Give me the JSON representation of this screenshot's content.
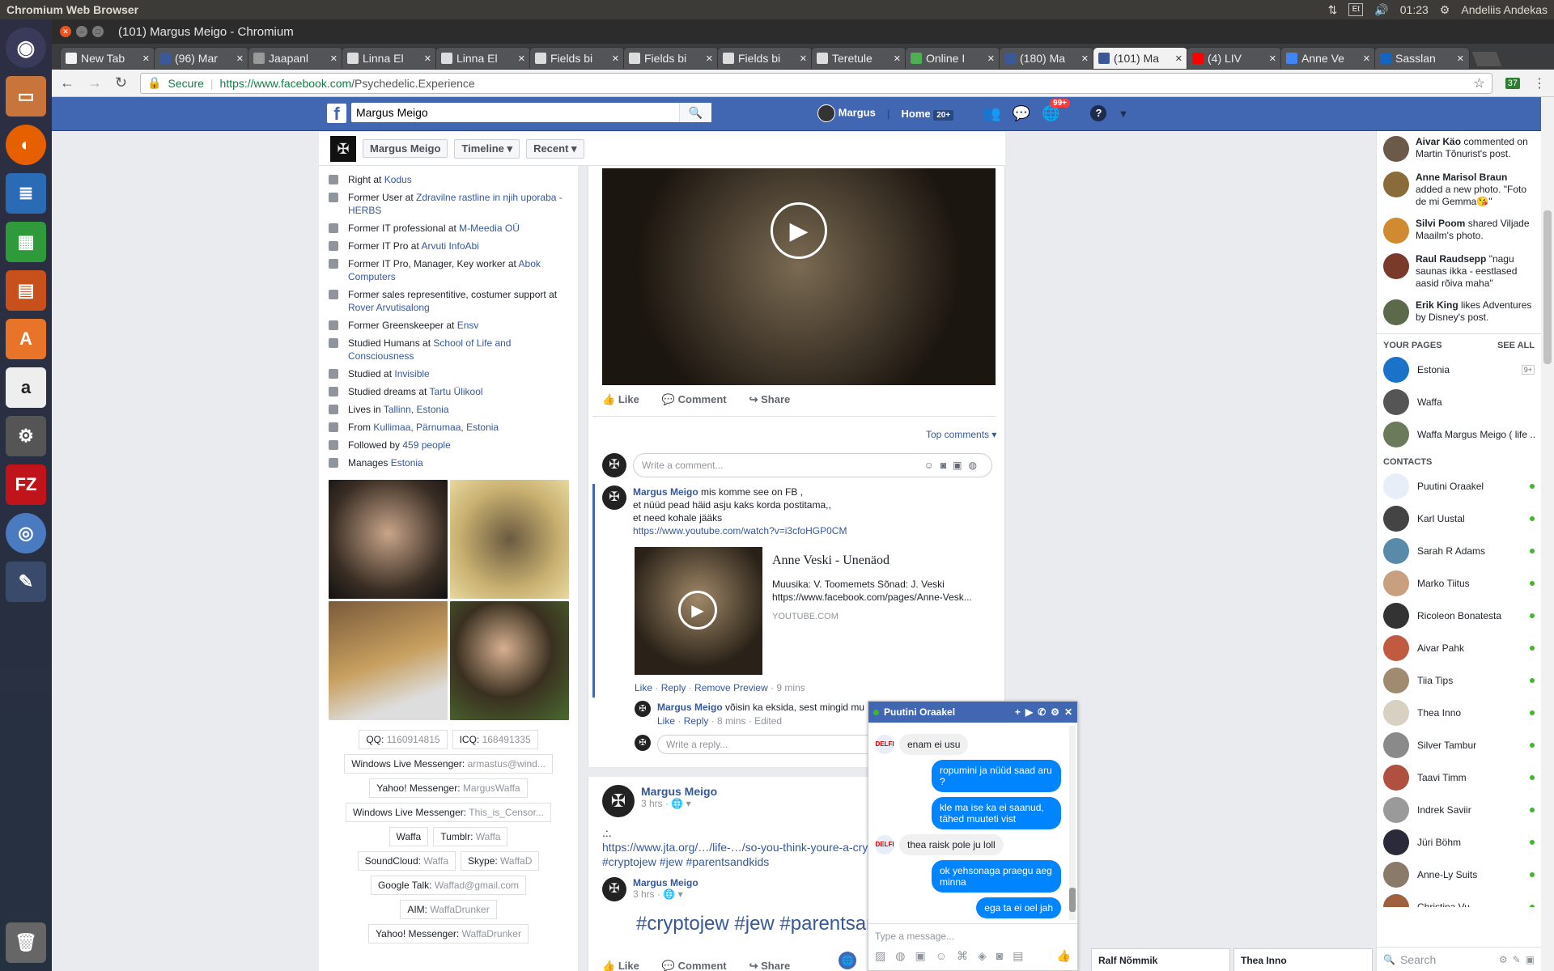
{
  "os": {
    "app_title": "Chromium Web Browser",
    "clock": "01:23",
    "keyboard": "Et",
    "user": "Andeliis Andekas"
  },
  "window": {
    "title": "(101) Margus Meigo - Chromium"
  },
  "tabs": [
    {
      "label": "New Tab",
      "color": "#f2f2f2"
    },
    {
      "label": "(96) Mar",
      "color": "#3b5998"
    },
    {
      "label": "Jaapanl",
      "color": "#999999"
    },
    {
      "label": "Linna El",
      "color": "#dddddd"
    },
    {
      "label": "Linna El",
      "color": "#dddddd"
    },
    {
      "label": "Fields bi",
      "color": "#dddddd"
    },
    {
      "label": "Fields bi",
      "color": "#dddddd"
    },
    {
      "label": "Fields bi",
      "color": "#dddddd"
    },
    {
      "label": "Teretule",
      "color": "#dddddd"
    },
    {
      "label": "Online I",
      "color": "#4caf50"
    },
    {
      "label": "(180) Ma",
      "color": "#3b5998"
    },
    {
      "label": "(101) Ma",
      "color": "#3b5998",
      "active": true
    },
    {
      "label": "(4) LIV",
      "color": "#ff0000"
    },
    {
      "label": "Anne Ve",
      "color": "#4285f4"
    },
    {
      "label": "Sasslan",
      "color": "#1565c0"
    }
  ],
  "address": {
    "secure": "Secure",
    "url_prefix": "https://www.facebook.com",
    "url_path": "/Psychedelic.Experience",
    "ext_badge": "37"
  },
  "fb": {
    "logo": "f",
    "search_value": "Margus Meigo",
    "user": "Margus",
    "home": "Home",
    "home_count": "20+",
    "notif_count": "99+",
    "help": "?"
  },
  "subnav": {
    "name": "Margus Meigo",
    "timeline": "Timeline",
    "recent": "Recent"
  },
  "about": [
    {
      "pre": "Right at ",
      "link": "Kodus",
      "icon": "briefcase-icon"
    },
    {
      "pre": "Former User at ",
      "link": "Zdravilne rastline in njih uporaba - HERBS",
      "icon": "briefcase-icon"
    },
    {
      "pre": "Former IT professional at ",
      "link": "M-Meedia OÜ",
      "icon": "briefcase-icon"
    },
    {
      "pre": "Former IT Pro at ",
      "link": "Arvuti InfoAbi",
      "icon": "briefcase-icon"
    },
    {
      "pre": "Former IT Pro, Manager, Key worker at ",
      "link": "Abok Computers",
      "icon": "briefcase-icon"
    },
    {
      "pre": "Former sales representitive, costumer support at ",
      "link": "Rover Arvutisalong",
      "icon": "briefcase-icon"
    },
    {
      "pre": "Former Greenskeeper at ",
      "link": "Ensv",
      "icon": "briefcase-icon"
    },
    {
      "pre": "Studied Humans at ",
      "link": "School of Life and Consciousness",
      "icon": "graduation-cap-icon"
    },
    {
      "pre": "Studied at ",
      "link": "Invisible",
      "icon": "graduation-cap-icon"
    },
    {
      "pre": "Studied dreams at ",
      "link": "Tartu Ülikool",
      "icon": "graduation-cap-icon"
    },
    {
      "pre": "Lives in ",
      "link": "Tallinn, Estonia",
      "icon": "home-icon"
    },
    {
      "pre": "From ",
      "link": "Kullimaa, Pärnumaa, Estonia",
      "icon": "location-pin-icon"
    },
    {
      "pre": "Followed by ",
      "link": "459 people",
      "icon": "rss-icon"
    },
    {
      "pre": "Manages ",
      "link": "Estonia",
      "icon": "flag-icon"
    }
  ],
  "contacts_info": [
    [
      {
        "k": "QQ:",
        "v": "1160914815"
      },
      {
        "k": "ICQ:",
        "v": "168491335"
      }
    ],
    [
      {
        "k": "Windows Live Messenger:",
        "v": "armastus@wind..."
      }
    ],
    [
      {
        "k": "Yahoo! Messenger:",
        "v": "MargusWaffa"
      }
    ],
    [
      {
        "k": "Windows Live Messenger:",
        "v": "This_is_Censor..."
      }
    ],
    [
      {
        "k": "Waffa",
        "v": ""
      },
      {
        "k": "Tumblr:",
        "v": "Waffa"
      }
    ],
    [
      {
        "k": "SoundCloud:",
        "v": "Waffa"
      },
      {
        "k": "Skype:",
        "v": "WaffaD"
      }
    ],
    [
      {
        "k": "Google Talk:",
        "v": "Waffad@gmail.com"
      }
    ],
    [
      {
        "k": "AIM:",
        "v": "WaffaDrunker"
      }
    ],
    [
      {
        "k": "Yahoo! Messenger:",
        "v": "WaffaDrunker"
      }
    ]
  ],
  "post1": {
    "like": "Like",
    "comment": "Comment",
    "share": "Share",
    "top_comments": "Top comments",
    "write_comment": "Write a comment...",
    "c1_author": "Margus Meigo",
    "c1_line1": "mis komme see on FB ,",
    "c1_line2": "et nüüd pead häid asju kaks korda postitama,,",
    "c1_line3": "et need kohale jääks",
    "c1_link": "https://www.youtube.com/watch?v=i3cfoHGP0CM",
    "preview_title": "Anne Veski - Unenäod",
    "preview_desc1": "Muusika: V. Toomemets Sõnad: J. Veski",
    "preview_desc2": "https://www.facebook.com/pages/Anne-Vesk...",
    "preview_source": "YOUTUBE.COM",
    "c1_like": "Like",
    "c1_reply": "Reply",
    "c1_remove": "Remove Preview",
    "c1_time": "9 mins",
    "c2_author": "Margus Meigo",
    "c2_text": "võisin ka eksida, sest mingid mu",
    "c2_like": "Like",
    "c2_reply": "Reply",
    "c2_time": "8 mins",
    "c2_edited": "Edited",
    "write_reply": "Write a reply..."
  },
  "post2": {
    "author": "Margus Meigo",
    "time": "3 hrs",
    "text0": ".:.",
    "link": "https://www.jta.org/…/life-…/so-you-think-youre-a-cry",
    "tags": "#cryptojew #jew #parentsandkids",
    "sub_author": "Margus Meigo",
    "sub_time": "3 hrs",
    "big_tags": "#cryptojew #jew #parentsar",
    "like": "Like",
    "comment": "Comment",
    "share": "Share"
  },
  "chat": {
    "name": "Puutini Oraakel",
    "messages": [
      {
        "from": "them",
        "text": "enam ei usu"
      },
      {
        "from": "me",
        "text": "ropumini ja nüüd saad aru ?"
      },
      {
        "from": "me",
        "text": "kle ma ise ka ei saanud, tähed muuteti vist"
      },
      {
        "from": "them",
        "text": "thea raisk pole ju loll"
      },
      {
        "from": "me",
        "text": "ok yehsonaga praegu aeg minna"
      },
      {
        "from": "me",
        "text": "ega ta ei oel jah"
      }
    ],
    "placeholder": "Type a message..."
  },
  "ticker": [
    {
      "name": "Aivar Käo",
      "text": " commented on Martin Tõnurist's post.",
      "color": "#6b5a4a"
    },
    {
      "name": "Anne Marisol Braun",
      "text": " added a new photo. \"Foto de mi Gemma😘\"",
      "color": "#8a6b3a"
    },
    {
      "name": "Silvi Poom",
      "text": " shared Viljade Maailm's photo.",
      "color": "#d08a30"
    },
    {
      "name": "Raul Raudsepp",
      "text": " \"nagu saunas ikka - eestlased aasid rõiva maha\"",
      "color": "#7a3a2a"
    },
    {
      "name": "Erik King",
      "text": " likes Adventures by Disney's post.",
      "color": "#5a6a4a"
    }
  ],
  "your_pages": {
    "heading": "YOUR PAGES",
    "see_all": "SEE ALL",
    "items": [
      {
        "name": "Estonia",
        "badge": "9+",
        "color": "#1a73c8"
      },
      {
        "name": "Waffa",
        "badge": "",
        "color": "#555555"
      },
      {
        "name": "Waffa Margus Meigo ( life ...",
        "badge": "",
        "color": "#6a7a5a"
      }
    ]
  },
  "contacts": {
    "heading": "CONTACTS",
    "items": [
      {
        "name": "Puutini Oraakel",
        "color": "#e8eef8"
      },
      {
        "name": "Karl Uustal",
        "color": "#444444"
      },
      {
        "name": "Sarah R Adams",
        "color": "#5a8aaa"
      },
      {
        "name": "Marko Tiitus",
        "color": "#c8a080"
      },
      {
        "name": "Ricoleon Bonatesta",
        "color": "#333333"
      },
      {
        "name": "Aivar Pahk",
        "color": "#c05a40"
      },
      {
        "name": "Tiia Tips",
        "color": "#a08a70"
      },
      {
        "name": "Thea Inno",
        "color": "#d8d0c0"
      },
      {
        "name": "Silver Tambur",
        "color": "#8a8a8a"
      },
      {
        "name": "Taavi Timm",
        "color": "#b05040"
      },
      {
        "name": "Indrek Saviir",
        "color": "#9a9a9a"
      },
      {
        "name": "Jüri Böhm",
        "color": "#2a2a3a"
      },
      {
        "name": "Anne-Ly Suits",
        "color": "#8a7a6a"
      },
      {
        "name": "Christina Vu",
        "color": "#a06040"
      }
    ],
    "search_placeholder": "Search"
  },
  "bottom_chats": [
    "Ralf Nõmmik",
    "Thea Inno"
  ]
}
